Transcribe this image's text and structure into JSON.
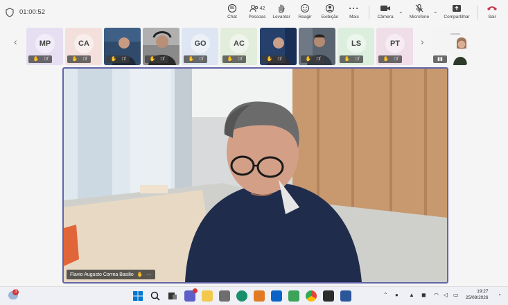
{
  "meeting": {
    "timer": "01:00:52"
  },
  "toolbar": {
    "chat": "Chat",
    "people": "Pessoas",
    "people_count": "42",
    "raise": "Levantar",
    "react": "Reagir",
    "view": "Exibição",
    "more": "Mais",
    "camera": "Câmera",
    "mic": "Microfone",
    "share": "Compartilhar",
    "leave": "Sair"
  },
  "participants": [
    {
      "initials": "MP",
      "color": "#e6dff2"
    },
    {
      "initials": "CA",
      "color": "#f3e0dd"
    },
    {
      "initials": "",
      "color": "#2f4a6a"
    },
    {
      "initials": "",
      "color": "#6b6b6b"
    },
    {
      "initials": "GO",
      "color": "#dde6f2"
    },
    {
      "initials": "AC",
      "color": "#e2eddc"
    },
    {
      "initials": "",
      "color": "#24406b"
    },
    {
      "initials": "",
      "color": "#5a6470"
    },
    {
      "initials": "LS",
      "color": "#dceede"
    },
    {
      "initials": "PT",
      "color": "#efdde8"
    }
  ],
  "main_speaker": {
    "name": "Flavio Augusto Correa Basilio"
  },
  "taskbar": {
    "notification_count": "3"
  },
  "clock": {
    "time": "19:27",
    "date": "25/08/2026"
  }
}
